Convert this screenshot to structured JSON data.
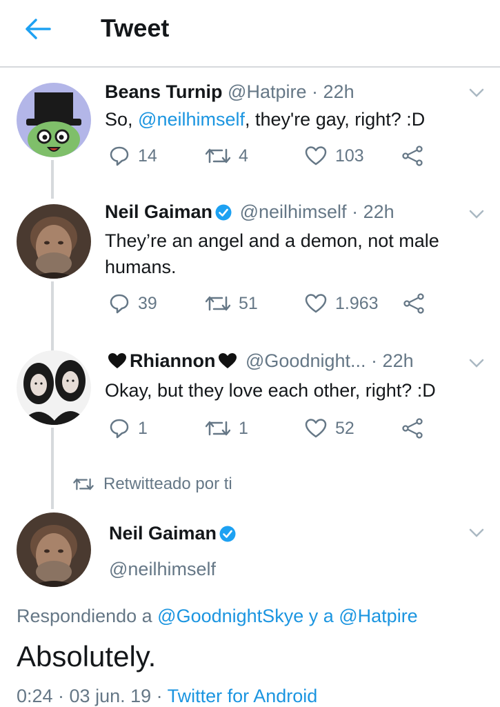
{
  "header": {
    "title": "Tweet"
  },
  "tweets": [
    {
      "name": "Beans Turnip",
      "handle": "@Hatpire",
      "dot": "·",
      "time": "22h",
      "text_prefix": "So, ",
      "text_mention": "@neilhimself",
      "text_suffix": ", they're gay, right? :D",
      "replies": "14",
      "retweets": "4",
      "likes": "103"
    },
    {
      "name": "Neil Gaiman",
      "handle": "@neilhimself",
      "dot": "·",
      "time": "22h",
      "text": "They’re an angel and a demon, not male humans.",
      "replies": "39",
      "retweets": "51",
      "likes": "1.963"
    },
    {
      "name": "Rhiannon",
      "handle": "@Goodnight...",
      "dot": "·",
      "time": "22h",
      "text": "Okay, but they love each other, right? :D",
      "replies": "1",
      "retweets": "1",
      "likes": "52"
    }
  ],
  "retweeted_by": "Retwitteado por ti",
  "main": {
    "name": "Neil Gaiman",
    "handle": "@neilhimself",
    "replying_prefix": "Respondiendo a ",
    "replying_user1": "@GoodnightSkye",
    "replying_and": " y a ",
    "replying_user2": "@Hatpire",
    "text": "Absolutely.",
    "time": "0:24 · 03 jun. 19 · ",
    "source": "Twitter for Android"
  },
  "colors": {
    "accent": "#1b95e0",
    "muted": "#657786",
    "verified": "#1da1f2"
  },
  "icons": [
    "back-arrow-icon",
    "chevron-down-icon",
    "reply-icon",
    "retweet-icon",
    "like-icon",
    "share-icon",
    "verified-icon",
    "black-heart-icon"
  ]
}
